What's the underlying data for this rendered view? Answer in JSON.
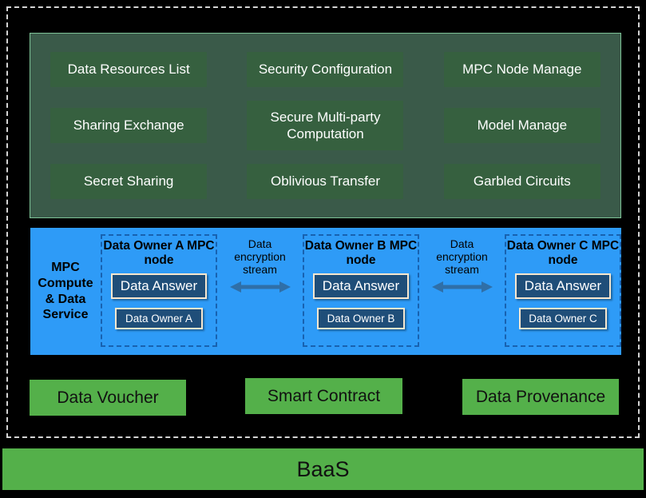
{
  "services_panel": {
    "rows": [
      [
        {
          "label": "Data Resources List"
        },
        {
          "label": "Security Configuration"
        },
        {
          "label": "MPC Node Manage"
        }
      ],
      [
        {
          "label": "Sharing Exchange"
        },
        {
          "label": "Secure Multi-party Computation"
        },
        {
          "label": "Model Manage"
        }
      ],
      [
        {
          "label": "Secret Sharing"
        },
        {
          "label": "Oblivious Transfer"
        },
        {
          "label": "Garbled Circuits"
        }
      ]
    ]
  },
  "mpc_panel": {
    "title": "MPC Compute & Data Service",
    "nodes": [
      {
        "title": "Data Owner A MPC node",
        "answer": "Data Answer",
        "owner": "Data Owner A"
      },
      {
        "title": "Data Owner B MPC node",
        "answer": "Data Answer",
        "owner": "Data Owner B"
      },
      {
        "title": "Data Owner C MPC node",
        "answer": "Data Answer",
        "owner": "Data Owner C"
      }
    ],
    "streams": [
      {
        "label": "Data encryption stream"
      },
      {
        "label": "Data encryption stream"
      }
    ]
  },
  "blockchain_services": {
    "voucher": "Data Voucher",
    "contract": "Smart Contract",
    "provenance": "Data Provenance"
  },
  "foundation": {
    "label": "BaaS"
  },
  "colors": {
    "background": "#000000",
    "services_panel": "#3a5a49",
    "services_panel_border": "#7ec497",
    "service_button": "#36603f",
    "mpc_panel": "#2e9bf7",
    "mpc_node_border": "#1862b0",
    "node_box": "#1f4e79",
    "node_box_border": "#f7e7cf",
    "blockchain_green": "#54b04a",
    "boundary_dash": "#d4d4d4",
    "arrow": "#2f6fa8"
  }
}
